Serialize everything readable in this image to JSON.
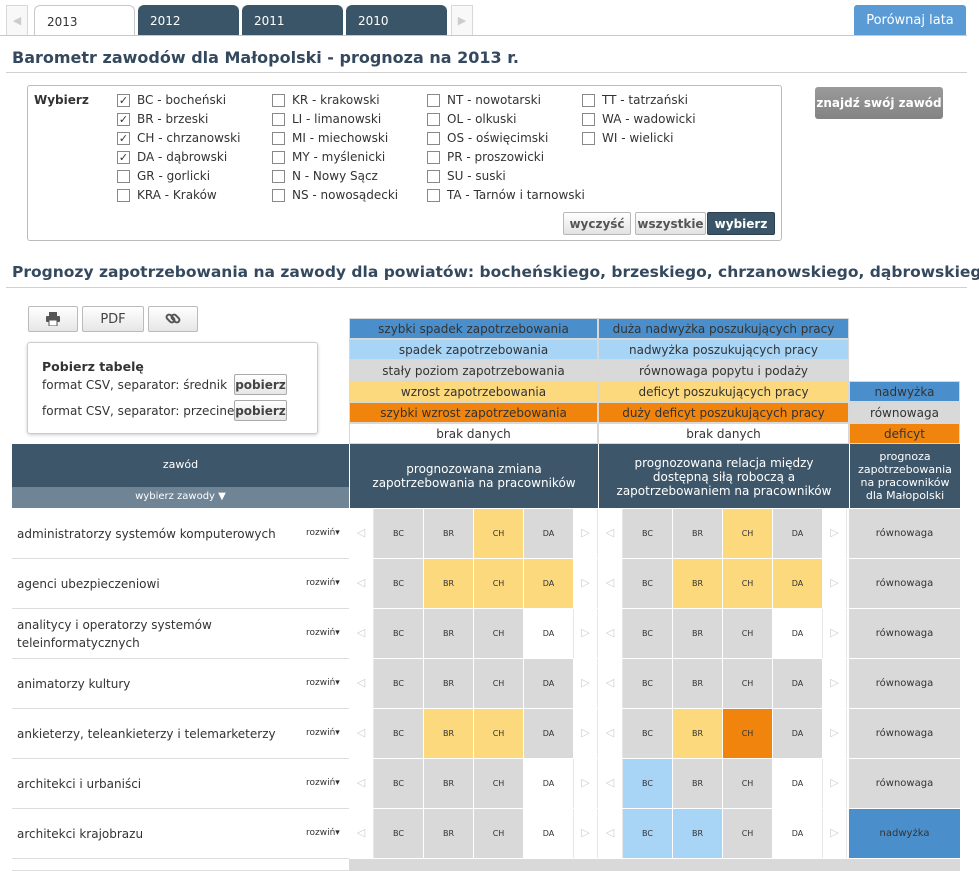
{
  "tabs": [
    {
      "label": "2013",
      "active": true
    },
    {
      "label": "2012"
    },
    {
      "label": "2011"
    },
    {
      "label": "2010"
    }
  ],
  "compare_label": "Porównaj lata",
  "title": "Barometr zawodów dla Małopolski - prognoza na 2013 r.",
  "selector": {
    "label": "Wybierz",
    "districts": [
      {
        "label": "BC - bocheński",
        "checked": true
      },
      {
        "label": "BR - brzeski",
        "checked": true
      },
      {
        "label": "CH - chrzanowski",
        "checked": true
      },
      {
        "label": "DA - dąbrowski",
        "checked": true
      },
      {
        "label": "GR - gorlicki",
        "checked": false
      },
      {
        "label": "KRA - Kraków",
        "checked": false
      },
      {
        "label": "KR - krakowski",
        "checked": false
      },
      {
        "label": "LI - limanowski",
        "checked": false
      },
      {
        "label": "MI - miechowski",
        "checked": false
      },
      {
        "label": "MY - myślenicki",
        "checked": false
      },
      {
        "label": "N - Nowy Sącz",
        "checked": false
      },
      {
        "label": "NS - nowosądecki",
        "checked": false
      },
      {
        "label": "NT - nowotarski",
        "checked": false
      },
      {
        "label": "OL - olkuski",
        "checked": false
      },
      {
        "label": "OS - oświęcimski",
        "checked": false
      },
      {
        "label": "PR - proszowicki",
        "checked": false
      },
      {
        "label": "SU - suski",
        "checked": false
      },
      {
        "label": "TA - Tarnów i tarnowski",
        "checked": false
      },
      {
        "label": "TT - tatrzański",
        "checked": false
      },
      {
        "label": "WA - wadowicki",
        "checked": false
      },
      {
        "label": "WI - wielicki",
        "checked": false
      }
    ],
    "clear_label": "wyczyść",
    "all_label": "wszystkie",
    "select_label": "wybierz",
    "check_mark": "✓"
  },
  "find_label": "znajdź swój zawód",
  "subtitle": "Prognozy zapotrzebowania na zawody dla powiatów: bocheńskiego, brzeskiego, chrzanowskiego, dąbrowskiego",
  "tools": {
    "print_icon": "printer-icon",
    "pdf_label": "PDF",
    "link_icon": "link-icon"
  },
  "download": {
    "title": "Pobierz tabelę",
    "rows": [
      {
        "label": "format CSV, separator: średnik",
        "button": "pobierz"
      },
      {
        "label": "format CSV, separator: przecinek",
        "button": "pobierz"
      }
    ]
  },
  "legend": {
    "demand": [
      "szybki spadek zapotrzebowania",
      "spadek zapotrzebowania",
      "stały poziom zapotrzebowania",
      "wzrost zapotrzebowania",
      "szybki wzrost zapotrzebowania",
      "brak danych"
    ],
    "relation": [
      "duża nadwyżka poszukujących pracy",
      "nadwyżka poszukujących pracy",
      "równowaga popytu i podaży",
      "deficyt poszukujących pracy",
      "duży deficyt poszukujących pracy",
      "brak danych"
    ],
    "malopolska": [
      "nadwyżka",
      "równowaga",
      "deficyt"
    ]
  },
  "colors": {
    "dark_blue": "#4a8fcc",
    "light_blue": "#a8d4f5",
    "gray": "#d9d9d9",
    "light_orange": "#fcd97c",
    "orange": "#f0840c",
    "white": "#ffffff",
    "header": "#3d5669",
    "header_sub": "#6f8494"
  },
  "table": {
    "col_zawod": "zawód",
    "col_wybierz": "wybierz zawody ▼",
    "col_demand": "prognozowana zmiana zapotrzebowania na pracowników",
    "col_relation": "prognozowana relacja między dostępną siłą roboczą a zapotrzebowaniem na pracowników",
    "col_malopolska": "prognoza zapotrzebowania na pracowników dla Małopolski",
    "expand_label": "rozwiń▾",
    "districts": [
      "BC",
      "BR",
      "CH",
      "DA"
    ],
    "rows": [
      {
        "name": "administratorzy systemów komputerowych",
        "demand": [
          "gray",
          "gray",
          "light_orange",
          "gray"
        ],
        "relation": [
          "gray",
          "gray",
          "light_orange",
          "gray"
        ],
        "malopolska": "równowaga",
        "mal_color": "gray"
      },
      {
        "name": "agenci ubezpieczeniowi",
        "demand": [
          "gray",
          "light_orange",
          "light_orange",
          "light_orange"
        ],
        "relation": [
          "gray",
          "light_orange",
          "light_orange",
          "light_orange"
        ],
        "malopolska": "równowaga",
        "mal_color": "gray"
      },
      {
        "name": "analitycy i operatorzy systemów teleinformatycznych",
        "demand": [
          "gray",
          "gray",
          "gray",
          "white"
        ],
        "relation": [
          "gray",
          "gray",
          "gray",
          "white"
        ],
        "malopolska": "równowaga",
        "mal_color": "gray"
      },
      {
        "name": "animatorzy kultury",
        "demand": [
          "gray",
          "gray",
          "gray",
          "gray"
        ],
        "relation": [
          "gray",
          "gray",
          "gray",
          "gray"
        ],
        "malopolska": "równowaga",
        "mal_color": "gray"
      },
      {
        "name": "ankieterzy, teleankieterzy i telemarketerzy",
        "demand": [
          "gray",
          "light_orange",
          "light_orange",
          "gray"
        ],
        "relation": [
          "gray",
          "light_orange",
          "orange",
          "gray"
        ],
        "malopolska": "równowaga",
        "mal_color": "gray"
      },
      {
        "name": "architekci i urbaniści",
        "demand": [
          "gray",
          "gray",
          "gray",
          "white"
        ],
        "relation": [
          "light_blue",
          "gray",
          "gray",
          "white"
        ],
        "malopolska": "równowaga",
        "mal_color": "gray"
      },
      {
        "name": "architekci krajobrazu",
        "demand": [
          "gray",
          "gray",
          "gray",
          "white"
        ],
        "relation": [
          "light_blue",
          "light_blue",
          "gray",
          "white"
        ],
        "malopolska": "nadwyżka",
        "mal_color": "dark_blue"
      }
    ]
  }
}
